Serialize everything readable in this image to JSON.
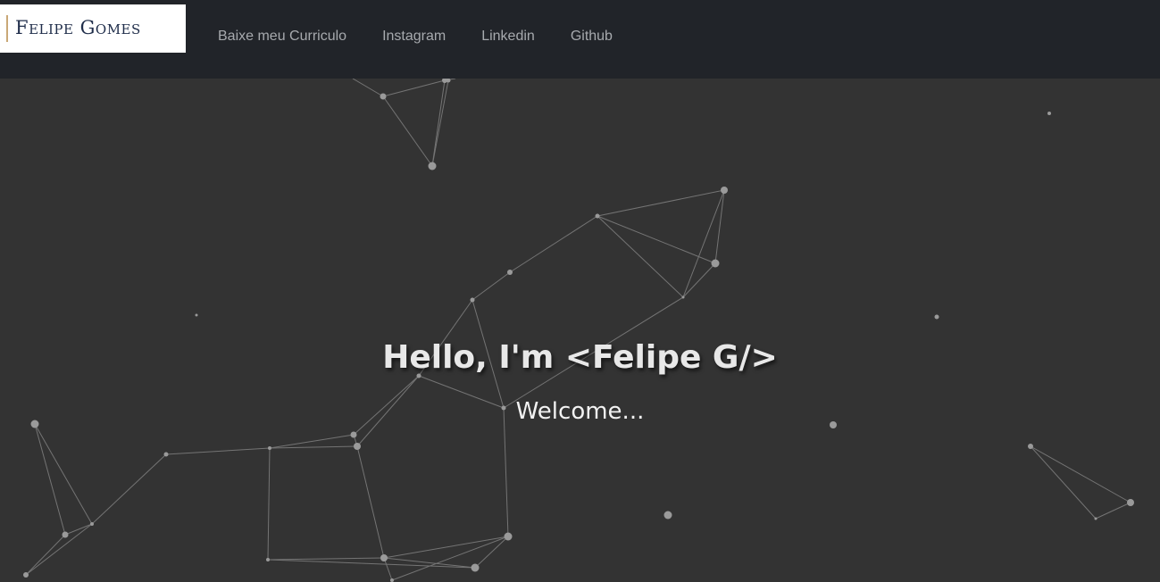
{
  "brand": {
    "name": "Felipe Gomes",
    "accent": "#c9a877",
    "text_color": "#1f2d4a"
  },
  "nav": {
    "links": [
      {
        "label": "Baixe meu Curriculo"
      },
      {
        "label": "Instagram"
      },
      {
        "label": "Linkedin"
      },
      {
        "label": "Github"
      }
    ]
  },
  "hero": {
    "title": "Hello, I'm <Felipe G/>",
    "subtitle": "Welcome...",
    "background": "#333333",
    "particle_color": "#9a9a9a"
  },
  "colors": {
    "navbar": "#212429",
    "nav_link": "#a7aaae"
  }
}
